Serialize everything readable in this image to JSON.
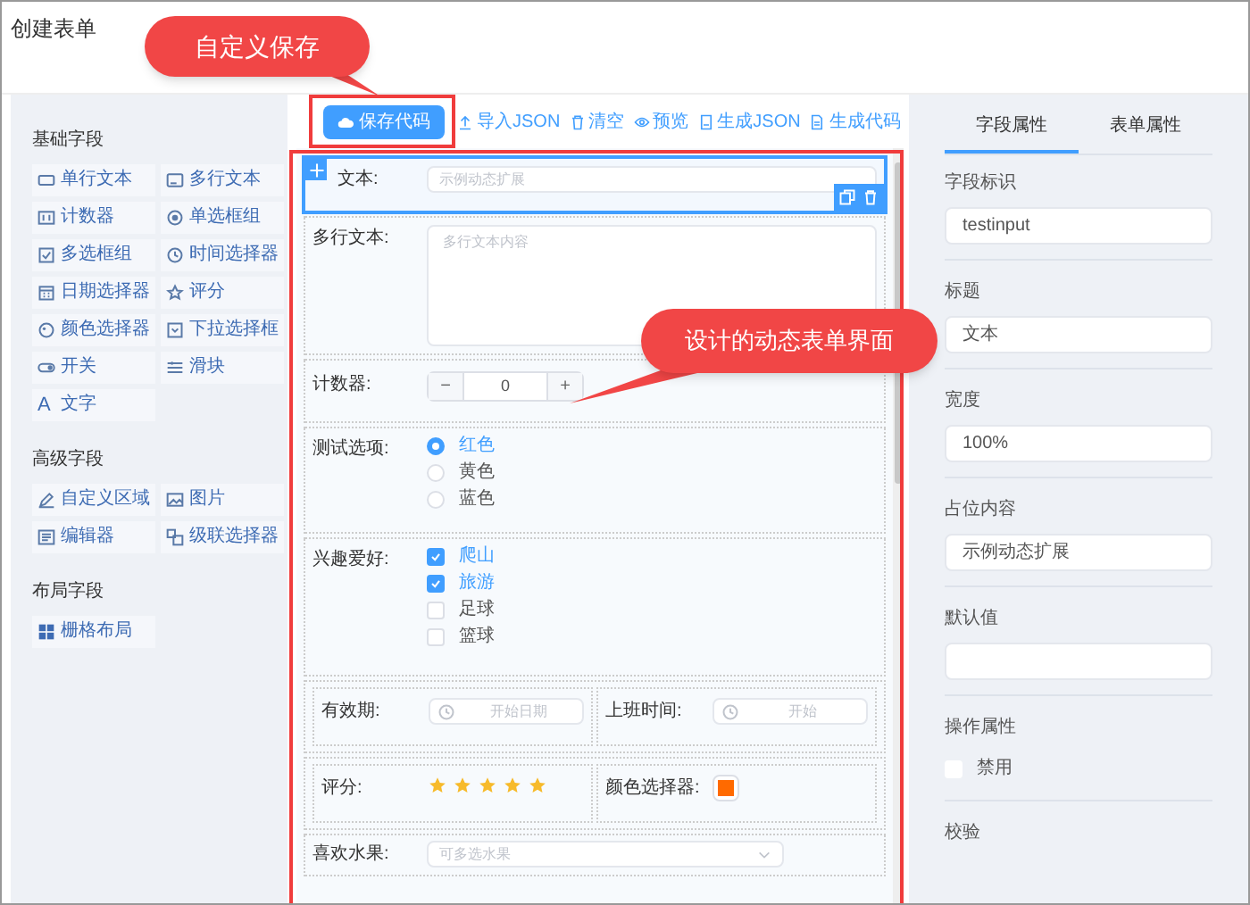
{
  "window": {
    "title": "创建表单"
  },
  "palette": [
    {
      "title": "基础字段",
      "items": [
        {
          "kind": "input",
          "label": "单行文本"
        },
        {
          "kind": "textarea",
          "label": "多行文本"
        },
        {
          "kind": "counter",
          "label": "计数器"
        },
        {
          "kind": "radio",
          "label": "单选框组"
        },
        {
          "kind": "checkbox",
          "label": "多选框组"
        },
        {
          "kind": "time",
          "label": "时间选择器"
        },
        {
          "kind": "date",
          "label": "日期选择器"
        },
        {
          "kind": "rate",
          "label": "评分"
        },
        {
          "kind": "color",
          "label": "颜色选择器"
        },
        {
          "kind": "select",
          "label": "下拉选择框"
        },
        {
          "kind": "switch",
          "label": "开关"
        },
        {
          "kind": "slider",
          "label": "滑块"
        },
        {
          "kind": "text",
          "label": "文字",
          "glyph": "A"
        }
      ]
    },
    {
      "title": "高级字段",
      "items": [
        {
          "kind": "custom",
          "label": "自定义区域"
        },
        {
          "kind": "image",
          "label": "图片"
        },
        {
          "kind": "editor",
          "label": "编辑器"
        },
        {
          "kind": "cascader",
          "label": "级联选择器"
        }
      ]
    },
    {
      "title": "布局字段",
      "items": [
        {
          "kind": "grid",
          "label": "栅格布局"
        }
      ]
    }
  ],
  "toolbar": {
    "save": "保存代码",
    "actions": [
      {
        "kind": "import",
        "label": "导入JSON"
      },
      {
        "kind": "clear",
        "label": "清空"
      },
      {
        "kind": "preview",
        "label": "预览"
      },
      {
        "kind": "json",
        "label": "生成JSON"
      },
      {
        "kind": "code",
        "label": "生成代码"
      }
    ]
  },
  "fields": [
    {
      "kind": "input",
      "label": "文本:",
      "placeholder": "示例动态扩展",
      "selected": true
    },
    {
      "kind": "textarea",
      "label": "多行文本:",
      "placeholder": "多行文本内容",
      "selected": false
    },
    {
      "kind": "counter",
      "label": "计数器:",
      "value": "0",
      "minus": "−",
      "plus": "+",
      "selected": false
    },
    {
      "kind": "radio",
      "label": "测试选项:",
      "selected": false,
      "options": [
        {
          "label": "红色",
          "selected": true
        },
        {
          "label": "黄色",
          "selected": false
        },
        {
          "label": "蓝色",
          "selected": false
        }
      ]
    },
    {
      "kind": "checkbox",
      "label": "兴趣爱好:",
      "selected": false,
      "options": [
        {
          "label": "爬山",
          "checked": true
        },
        {
          "label": "旅游",
          "checked": true
        },
        {
          "label": "足球",
          "checked": false
        },
        {
          "label": "篮球",
          "checked": false
        }
      ]
    },
    {
      "kind": "row",
      "selected": false,
      "cells": [
        {
          "kind": "time",
          "label": "有效期:",
          "placeholder": "开始日期"
        },
        {
          "kind": "time",
          "label": "上班时间:",
          "placeholder": "开始"
        }
      ]
    },
    {
      "kind": "row",
      "selected": false,
      "cells": [
        {
          "kind": "rate",
          "label": "评分:",
          "stars": 5
        },
        {
          "kind": "color",
          "label": "颜色选择器:",
          "color": "#ff6a00"
        }
      ]
    },
    {
      "kind": "select",
      "label": "喜欢水果:",
      "placeholder": "可多选水果",
      "selected": false
    }
  ],
  "properties": {
    "tabs": [
      {
        "label": "字段属性",
        "selected": true
      },
      {
        "label": "表单属性",
        "selected": false
      }
    ],
    "items": [
      {
        "kind": "input",
        "label": "字段标识",
        "value": "testinput"
      },
      {
        "kind": "input",
        "label": "标题",
        "value": "文本"
      },
      {
        "kind": "input",
        "label": "宽度",
        "value": "100%"
      },
      {
        "kind": "input",
        "label": "占位内容",
        "value": "示例动态扩展"
      },
      {
        "kind": "input",
        "label": "默认值"
      },
      {
        "kind": "checkbox",
        "label": "操作属性",
        "option": {
          "label": "禁用",
          "checked": false
        }
      },
      {
        "kind": "heading",
        "label": "校验"
      }
    ]
  },
  "annotations": [
    {
      "text": "自定义保存"
    },
    {
      "text": "设计的动态表单界面"
    }
  ]
}
